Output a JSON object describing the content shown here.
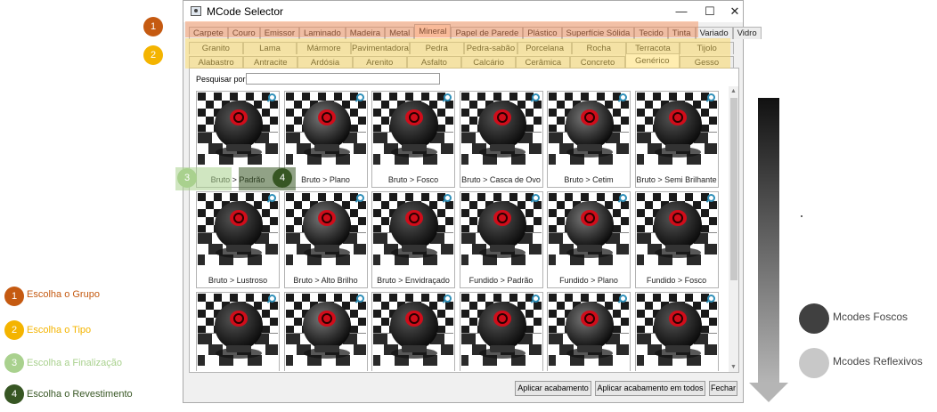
{
  "window": {
    "title": "MCode Selector"
  },
  "group_tabs": [
    "Carpete",
    "Couro",
    "Emissor",
    "Laminado",
    "Madeira",
    "Metal",
    "Mineral",
    "Papel de Parede",
    "Plástico",
    "Superfície Sólida",
    "Tecido",
    "Tinta",
    "Variado",
    "Vidro"
  ],
  "group_active": "Mineral",
  "type_tabs_row1": [
    "Granito",
    "Lama",
    "Mármore",
    "Pavimentadora",
    "Pedra",
    "Pedra-sabão",
    "Porcelana",
    "Rocha",
    "Terracota",
    "Tijolo"
  ],
  "type_tabs_row2": [
    "Alabastro",
    "Antracite",
    "Ardósia",
    "Arenito",
    "Asfalto",
    "Calcário",
    "Cerâmica",
    "Concreto",
    "Genérico",
    "Gesso"
  ],
  "type_active": "Genérico",
  "search": {
    "label": "Pesquisar por:",
    "value": ""
  },
  "materials": [
    "Bruto > Padrão",
    "Bruto > Plano",
    "Bruto > Fosco",
    "Bruto > Casca de Ovo",
    "Bruto > Cetim",
    "Bruto > Semi Brilhante",
    "Bruto > Lustroso",
    "Bruto > Alto Brilho",
    "Bruto > Envidraçado",
    "Fundido > Padrão",
    "Fundido > Plano",
    "Fundido > Fosco",
    "",
    "",
    "",
    "",
    "",
    ""
  ],
  "buttons": {
    "apply": "Aplicar acabamento",
    "apply_all": "Aplicar acabamento em todos",
    "close": "Fechar"
  },
  "steps": [
    {
      "num": "1",
      "label": "Escolha o Grupo",
      "color": "#c55a11"
    },
    {
      "num": "2",
      "label": "Escolha o Tipo",
      "color": "#f4b400"
    },
    {
      "num": "3",
      "label": "Escolha a Finalização",
      "color": "#a9d18e"
    },
    {
      "num": "4",
      "label": "Escolha o Revestimento",
      "color": "#375623"
    }
  ],
  "legend": {
    "matte": "Mcodes Foscos",
    "reflective": "Mcodes Reflexivos"
  },
  "colors": {
    "group_highlight": "#f8cbad",
    "type_highlight": "#ffe699",
    "matte_dot": "#404040",
    "reflective_dot": "#c8c8c8"
  },
  "icons": {
    "magnifier": "zoom-icon",
    "window": "app-icon"
  }
}
